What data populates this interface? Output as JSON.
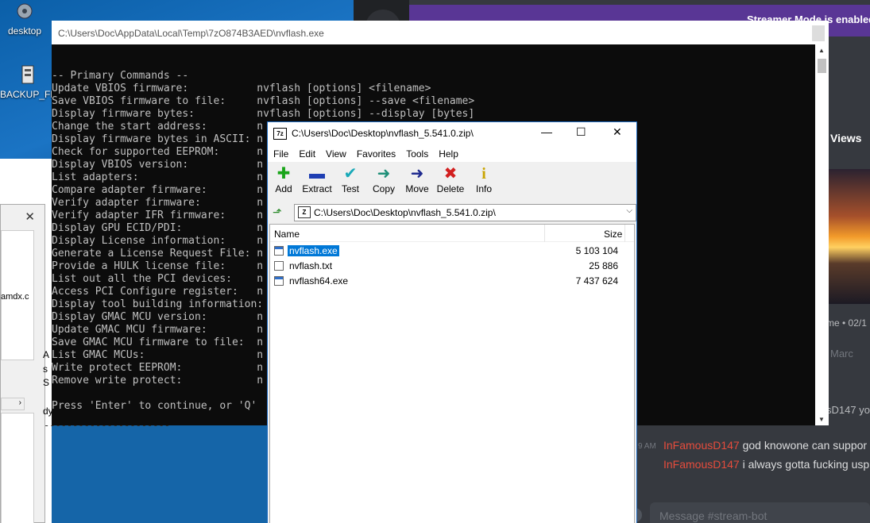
{
  "desktop": {
    "icons": [
      {
        "label": "desktop",
        "icon": "gear-icon"
      },
      {
        "label": "BACKUP_FPT",
        "icon": "application-icon"
      }
    ]
  },
  "discord": {
    "banner": "Streamer Mode is enabled",
    "views_label": "Views",
    "meta": "me • 02/1",
    "marc": "Marc",
    "partial_user": "sD147 yo",
    "time": "9 AM",
    "messages": [
      {
        "user": "InFamousD147",
        "text": "god knowone can suppor"
      },
      {
        "user": "InFamousD147",
        "text": "i always gotta fucking usp"
      }
    ],
    "message_placeholder": "Message #stream-bot",
    "user_color": "#e74c3c",
    "banner_color": "#593695"
  },
  "left_dialog": {
    "close": "✕",
    "amdx": "amdx.c",
    "scroll_arrow": "›",
    "frags": [
      "A",
      "s",
      "S",
      "dy"
    ],
    "dashes": "----------------------"
  },
  "console": {
    "title": "C:\\Users\\Doc\\AppData\\Local\\Temp\\7zO874B3AED\\nvflash.exe",
    "lines": [
      "-- Primary Commands --",
      "Update VBIOS firmware:           nvflash [options] <filename>",
      "Save VBIOS firmware to file:     nvflash [options] --save <filename>",
      "Display firmware bytes:          nvflash [options] --display [bytes]",
      "Change the start address:        n",
      "Display firmware bytes in ASCII: n",
      "Check for supported EEPROM:      n",
      "Display VBIOS version:           n",
      "List adapters:                   n",
      "Compare adapter firmware:        n",
      "Verify adapter firmware:         n",
      "Verify adapter IFR firmware:     n",
      "Display GPU ECID/PDI:            n",
      "Display License information:     n",
      "Generate a License Request File: n",
      "Provide a HULK license file:     n",
      "List out all the PCI devices:    n",
      "Access PCI Configure register:   n",
      "Display tool building information:",
      "Display GMAC MCU version:        n",
      "Update GMAC MCU firmware:        n",
      "Save GMAC MCU firmware to file:  n",
      "List GMAC MCUs:                  n",
      "Write protect EEPROM:            n",
      "Remove write protect:            n",
      "",
      "Press 'Enter' to continue, or 'Q'"
    ]
  },
  "zip": {
    "logo": "7z",
    "title": "C:\\Users\\Doc\\Desktop\\nvflash_5.541.0.zip\\",
    "window_buttons": {
      "minimize": "—",
      "maximize": "☐",
      "close": "✕"
    },
    "menu": [
      "File",
      "Edit",
      "View",
      "Favorites",
      "Tools",
      "Help"
    ],
    "toolbar": [
      {
        "label": "Add",
        "icon": "plus-icon",
        "glyph": "✚",
        "color": "#1aa51a"
      },
      {
        "label": "Extract",
        "icon": "minus-icon",
        "glyph": "▬",
        "color": "#1f3fb3"
      },
      {
        "label": "Test",
        "icon": "check-icon",
        "glyph": "✔",
        "color": "#19a9b8"
      },
      {
        "label": "Copy",
        "icon": "copy-arrow-icon",
        "glyph": "➜",
        "color": "#1e8f78"
      },
      {
        "label": "Move",
        "icon": "move-arrow-icon",
        "glyph": "➜",
        "color": "#1f2a8f"
      },
      {
        "label": "Delete",
        "icon": "delete-x-icon",
        "glyph": "✖",
        "color": "#d21f1f"
      },
      {
        "label": "Info",
        "icon": "info-icon",
        "glyph": "i",
        "color": "#c9a400"
      }
    ],
    "address": "C:\\Users\\Doc\\Desktop\\nvflash_5.541.0.zip\\",
    "columns": {
      "name": "Name",
      "size": "Size"
    },
    "files": [
      {
        "name": "nvflash.exe",
        "size": "5 103 104",
        "type": "exe",
        "selected": true
      },
      {
        "name": "nvflash.txt",
        "size": "25 886",
        "type": "txt",
        "selected": false
      },
      {
        "name": "nvflash64.exe",
        "size": "7 437 624",
        "type": "exe",
        "selected": false
      }
    ]
  }
}
